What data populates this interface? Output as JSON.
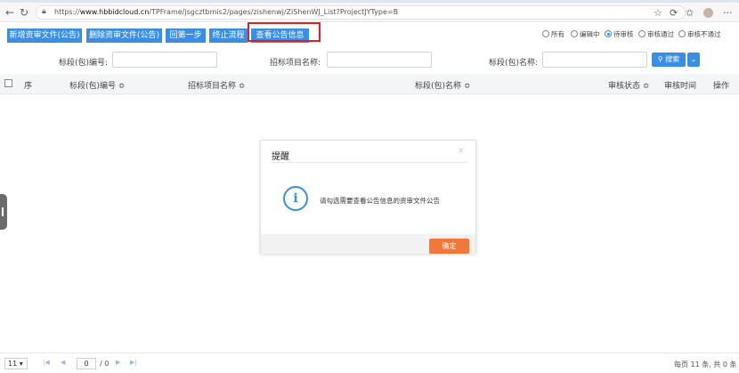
{
  "browser": {
    "url_prefix": "https://",
    "url_host": "www.hbbidcloud.cn",
    "url_path": "/TPFrame/jsgcztbmis2/pages/zishenwj/ZiShenWJ_List?ProjectJYType=B"
  },
  "toolbar": {
    "buttons": [
      "新增资审文件(公告)",
      "删除资审文件(公告)",
      "回第一步",
      "终止流程",
      "查看公告信息"
    ],
    "filters": [
      {
        "label": "所有",
        "selected": false
      },
      {
        "label": "编辑中",
        "selected": false
      },
      {
        "label": "待审核",
        "selected": true
      },
      {
        "label": "审核通过",
        "selected": false
      },
      {
        "label": "审核不通过",
        "selected": false
      }
    ]
  },
  "search": {
    "field1_label": "标段(包)编号:",
    "field2_label": "招标项目名称:",
    "field3_label": "标段(包)名称:",
    "search_button": "搜索"
  },
  "table": {
    "columns": [
      "序",
      "标段(包)编号 ≎",
      "招标项目名称 ≎",
      "标段(包)名称 ≎",
      "审核状态 ≎",
      "审核时间",
      "操作"
    ]
  },
  "dialog": {
    "title": "提醒",
    "close": "×",
    "icon": "info-icon",
    "message": "请勾选需要查看公告信息的资审文件公告",
    "ok": "确定"
  },
  "pager": {
    "page_size": "11",
    "current_page": "0",
    "total_pages": "/ 0",
    "summary": "每页 11 条, 共 0 条"
  },
  "colors": {
    "primary": "#3a8ee6",
    "confirm": "#f0783a",
    "highlight": "#e0201c"
  }
}
